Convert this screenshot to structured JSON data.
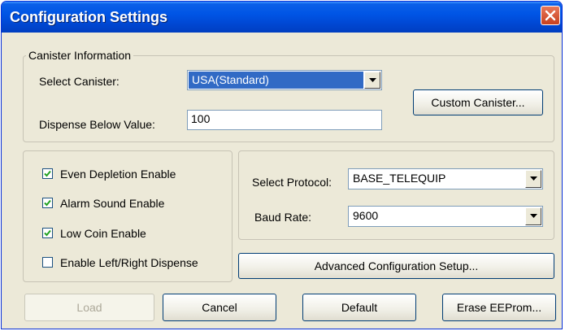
{
  "window": {
    "title": "Configuration Settings"
  },
  "canister": {
    "legend": "Canister Information",
    "select_label": "Select Canister:",
    "select_value": "USA(Standard)",
    "custom_button": "Custom Canister...",
    "dispense_label": "Dispense Below Value:",
    "dispense_value": "100"
  },
  "options": [
    {
      "label": "Even Depletion Enable",
      "checked": true
    },
    {
      "label": "Alarm Sound Enable",
      "checked": true
    },
    {
      "label": "Low Coin Enable",
      "checked": true
    },
    {
      "label": "Enable Left/Right Dispense",
      "checked": false
    }
  ],
  "protocol": {
    "protocol_label": "Select Protocol:",
    "protocol_value": "BASE_TELEQUIP",
    "baud_label": "Baud Rate:",
    "baud_value": "9600"
  },
  "advanced_button": "Advanced Configuration Setup...",
  "buttons": {
    "load": "Load",
    "cancel": "Cancel",
    "default": "Default",
    "erase": "Erase EEProm..."
  },
  "icons": {
    "close": "close-icon",
    "dropdown": "chevron-down-icon",
    "check": "check-icon"
  },
  "colors": {
    "titlebar": "#0055e5",
    "close": "#d44a26",
    "face": "#ece9d8",
    "selection": "#316ac5"
  }
}
